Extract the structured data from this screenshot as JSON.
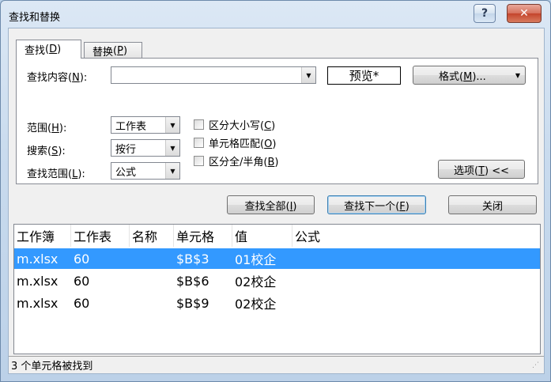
{
  "window": {
    "title": "查找和替换",
    "help_glyph": "?",
    "close_glyph": "✕"
  },
  "tabs": [
    {
      "label": "查找",
      "key": "D",
      "active": true
    },
    {
      "label": "替换",
      "key": "P",
      "active": false
    }
  ],
  "find": {
    "label": "查找内容",
    "key": "N",
    "value": "",
    "preview_label": "预览*",
    "format_button": "格式",
    "format_key": "M",
    "format_suffix": "..."
  },
  "options": {
    "scope": {
      "label": "范围",
      "key": "H",
      "value": "工作表"
    },
    "search": {
      "label": "搜索",
      "key": "S",
      "value": "按行"
    },
    "look_in": {
      "label": "查找范围",
      "key": "L",
      "value": "公式"
    },
    "match_case": {
      "label": "区分大小写",
      "key": "C",
      "checked": false
    },
    "match_cell": {
      "label": "单元格匹配",
      "key": "O",
      "checked": false
    },
    "match_byte": {
      "label": "区分全/半角",
      "key": "B",
      "checked": false
    },
    "options_button": "选项",
    "options_key": "T",
    "options_suffix": "<<"
  },
  "actions": {
    "find_all": "查找全部",
    "find_all_key": "I",
    "find_next": "查找下一个",
    "find_next_key": "F",
    "close": "关闭"
  },
  "results": {
    "columns": [
      "工作簿",
      "工作表",
      "名称",
      "单元格",
      "值",
      "公式"
    ],
    "rows": [
      [
        "m.xlsx",
        "60",
        "",
        "$B$3",
        "01校企",
        ""
      ],
      [
        "m.xlsx",
        "60",
        "",
        "$B$6",
        "02校企",
        ""
      ],
      [
        "m.xlsx",
        "60",
        "",
        "$B$9",
        "02校企",
        ""
      ]
    ],
    "selected_row": 0
  },
  "status": {
    "text": "3 个单元格被找到"
  },
  "colors": {
    "selection": "#3399ff",
    "dialog_bg": "#f0f0f0",
    "frame": "#c9dbee"
  }
}
